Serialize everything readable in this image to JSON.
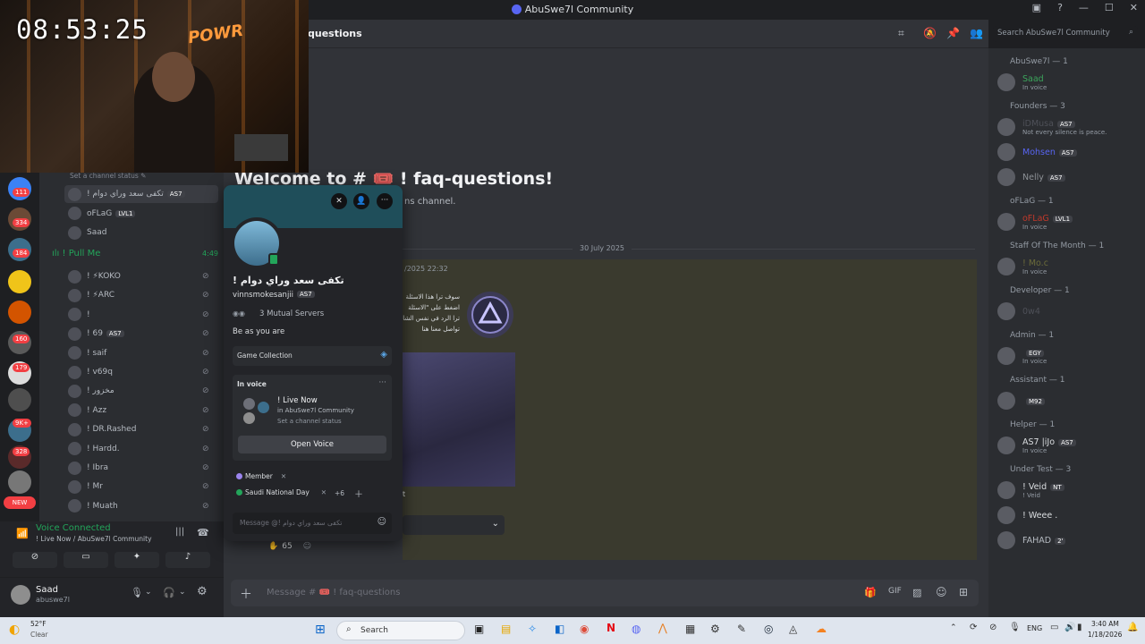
{
  "window": {
    "title": "AbuSwe7l Community"
  },
  "webcam": {
    "timer": "08:53:25",
    "logo_text": "POWR"
  },
  "servers": {
    "badges": [
      "111",
      "334",
      "184",
      "160",
      "179",
      "9K+",
      "328"
    ],
    "new_label": "NEW"
  },
  "channels": {
    "status_hint": "Set a channel status",
    "voice_users_top": [
      {
        "name": "! تكفى سعد وراي دوام",
        "tag": "AS7"
      },
      {
        "name": "oFLaG",
        "tag": "LVL1"
      },
      {
        "name": "Saad",
        "tag": ""
      }
    ],
    "pull_me": {
      "name": "! Pull Me",
      "time": "4:49"
    },
    "pull_me_users": [
      {
        "name": "! ⚡KOKO"
      },
      {
        "name": "! ⚡ARC"
      },
      {
        "name": "!"
      },
      {
        "name": "! 69",
        "tag": "AS7"
      },
      {
        "name": "! saif"
      },
      {
        "name": "! v69q"
      },
      {
        "name": "! مخزور"
      },
      {
        "name": "! Azz"
      },
      {
        "name": "! DR.Rashed"
      },
      {
        "name": "! Hardd."
      },
      {
        "name": "! Ibra"
      },
      {
        "name": "! Mr"
      },
      {
        "name": "! Muath"
      }
    ]
  },
  "voice": {
    "status": "Voice Connected",
    "location": "! Live Now / AbuSwe7l Community"
  },
  "user": {
    "name": "Saad",
    "handle": "abuswe7l"
  },
  "header": {
    "channel": "questions",
    "search_placeholder": "Search AbuSwe7l Community"
  },
  "welcome": {
    "title": "Welcome to # 🎟️ ! faq-questions!",
    "subtitle": "ns channel."
  },
  "date_divider": "30 July 2025",
  "message": {
    "timestamp": "/2025 22:32",
    "arabic_lines": [
      "سوف ترا هذا الاسئلة",
      "اضغط على \"الاسئلة",
      "ترا الرد في نفس الشا",
      "تواصل معنا هنا"
    ],
    "reaction_count": "65",
    "partial_text": "t"
  },
  "composer": {
    "placeholder": "Message # 🎟️ ! faq-questions"
  },
  "popup": {
    "display_name": "! تكفى سعد وراي دوام",
    "username": "vinnsmokesanjii",
    "tag": "AS7",
    "mutual": "3 Mutual Servers",
    "bio": "Be as you are",
    "game_collection": "Game Collection",
    "in_voice_label": "In voice",
    "voice_channel": "! Live Now",
    "voice_server": "in AbuSwe7l Community",
    "voice_status": "Set a channel status",
    "open_voice": "Open Voice",
    "roles": [
      "Member",
      "Saudi National Day"
    ],
    "more_roles": "+6",
    "message_placeholder": "Message @! تكفى سعد وراي دوام"
  },
  "members": {
    "groups": [
      {
        "title": "AbuSwe7l — 1",
        "users": [
          {
            "name": "Saad",
            "sub": "In voice",
            "tag": "",
            "color": "#3ba55c"
          }
        ]
      },
      {
        "title": "Founders — 3",
        "users": [
          {
            "name": "iDMusa",
            "sub": "Not every silence is peace.",
            "tag": "AS7",
            "color": "#4e5058"
          },
          {
            "name": "Mohsen",
            "sub": "",
            "tag": "AS7",
            "color": "#5865f2"
          },
          {
            "name": "Nelly",
            "sub": "",
            "tag": "AS7",
            "color": "#8e9297"
          }
        ]
      },
      {
        "title": "oFLaG — 1",
        "users": [
          {
            "name": "oFLaG",
            "sub": "In voice",
            "tag": "LVL1",
            "color": "#c0392b"
          }
        ]
      },
      {
        "title": "Staff Of The Month — 1",
        "users": [
          {
            "name": "! Mo.c",
            "sub": "In voice",
            "tag": "",
            "color": "#6b6b3a"
          }
        ]
      },
      {
        "title": "Developer — 1",
        "users": [
          {
            "name": "0w4",
            "sub": "",
            "tag": "",
            "color": "#4e5058"
          }
        ]
      },
      {
        "title": "Admin — 1",
        "users": [
          {
            "name": "",
            "sub": "In voice",
            "tag": "EGY",
            "color": "#7a1f1f"
          }
        ]
      },
      {
        "title": "Assistant — 1",
        "users": [
          {
            "name": "",
            "sub": "",
            "tag": "M92",
            "color": "#c0392b"
          }
        ]
      },
      {
        "title": "Helper — 1",
        "users": [
          {
            "name": "AS7 |iJo",
            "sub": "In voice",
            "tag": "AS7",
            "color": "#dbdee1"
          }
        ]
      },
      {
        "title": "Under Test — 3",
        "users": [
          {
            "name": "! Veid",
            "sub": "! Veid",
            "tag": "NT",
            "color": "#dbdee1"
          },
          {
            "name": "! Weee .",
            "sub": "",
            "tag": "",
            "color": "#dbdee1"
          },
          {
            "name": "FAHAD",
            "sub": "",
            "tag": "2'",
            "color": "#b5bac1"
          }
        ]
      }
    ]
  },
  "taskbar": {
    "weather_temp": "52°F",
    "weather_desc": "Clear",
    "search": "Search",
    "lang": "ENG",
    "time": "3:40 AM",
    "date": "1/18/2026"
  }
}
